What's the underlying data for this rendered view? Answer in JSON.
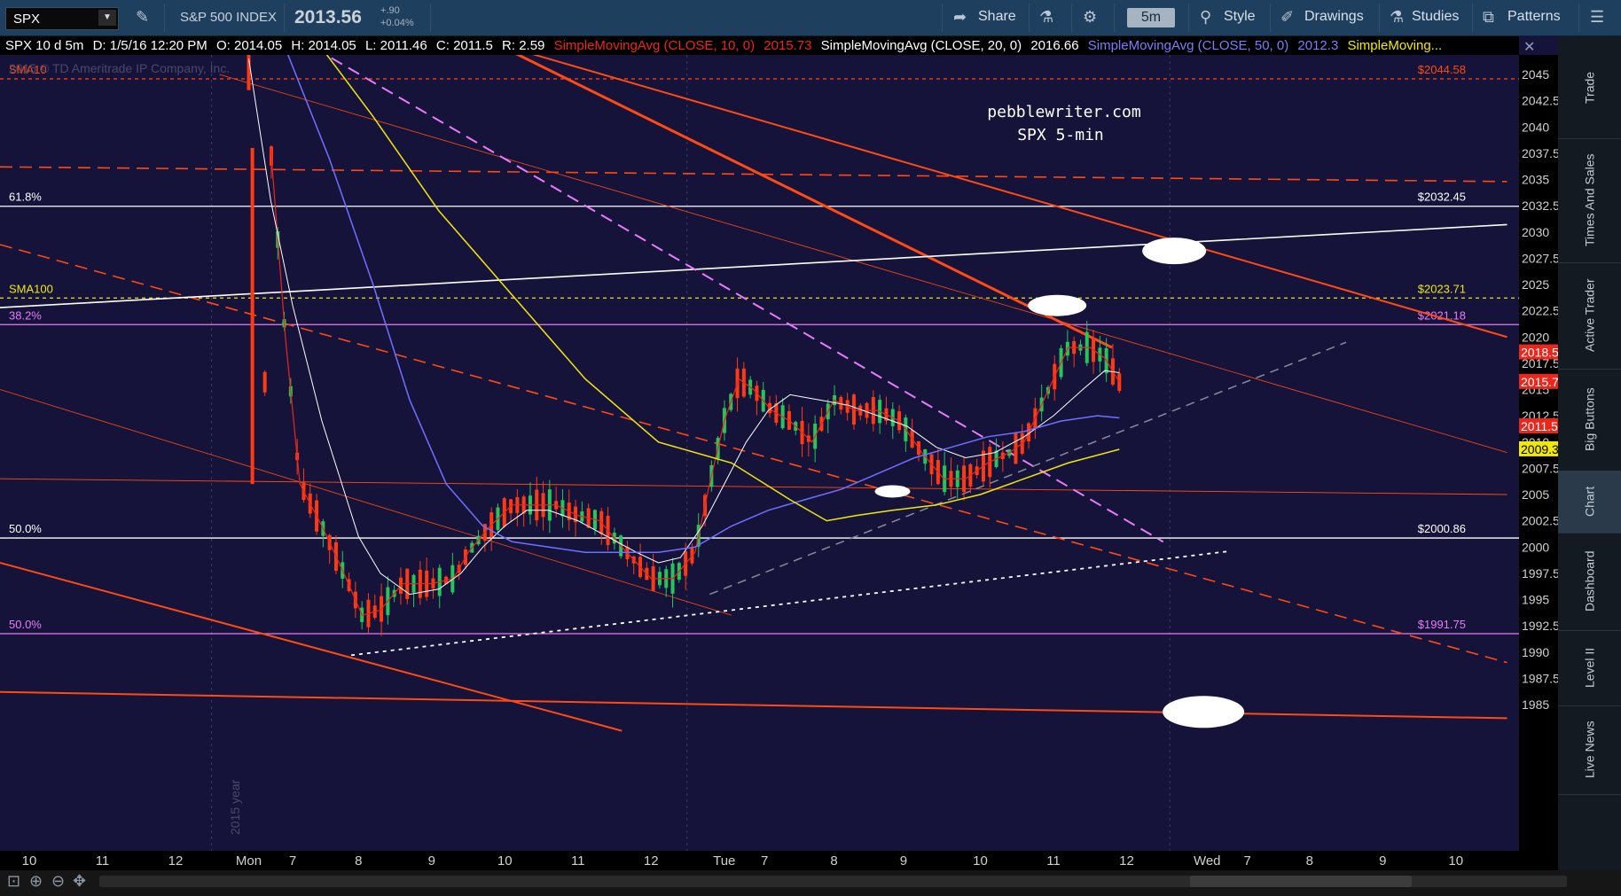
{
  "toolbar": {
    "symbol": "SPX",
    "index_name": "S&P 500 INDEX",
    "price": "2013.56",
    "change_abs": "+.90",
    "change_pct": "+0.04%",
    "share_label": "Share",
    "timeframe": "5m",
    "style_label": "Style",
    "drawings_label": "Drawings",
    "studies_label": "Studies",
    "patterns_label": "Patterns"
  },
  "info_bar": {
    "title": "SPX 10 d 5m",
    "date": "D: 1/5/16 12:20 PM",
    "open": "O: 2014.05",
    "high": "H: 2014.05",
    "low": "L: 2011.46",
    "close": "C: 2011.5",
    "range": "R: 2.59",
    "sma10_label": "SimpleMovingAvg (CLOSE, 10, 0)",
    "sma10_value": "2015.73",
    "sma20_label": "SimpleMovingAvg (CLOSE, 20, 0)",
    "sma20_value": "2016.66",
    "sma50_label": "SimpleMovingAvg (CLOSE, 50, 0)",
    "sma50_value": "2012.3",
    "more_label": "SimpleMoving..."
  },
  "sidebar": {
    "tabs": [
      "Trade",
      "Times And Sales",
      "Active Trader",
      "Big Buttons",
      "Chart",
      "Dashboard",
      "Level II",
      "Live News"
    ],
    "active": "Chart"
  },
  "colors": {
    "background": "#15133a",
    "candle_up": "#27c45a",
    "candle_down": "#ff3a12",
    "sma10": "#e8271d",
    "sma20": "#ffffff",
    "sma50": "#7070ff",
    "sma100": "#f0e80a",
    "fib_white": "#ffffff",
    "fib_magenta": "#e87cf8",
    "trend_orange": "#ff4a14"
  },
  "chart_data": {
    "type": "line",
    "title": "pebblewriter.com",
    "subtitle": "SPX 5-min",
    "copyright": "2015 © TD Ameritrade IP Company, Inc.",
    "year_marker": "2015 year",
    "ylim": [
      1982.5,
      2047.5
    ],
    "y_ticks": [
      2045,
      2042.5,
      2040,
      2037.5,
      2035,
      2032.5,
      2030,
      2027.5,
      2025,
      2022.5,
      2020,
      2017.5,
      2015,
      2012.5,
      2010,
      2007.5,
      2005,
      2002.5,
      2000,
      1997.5,
      1995,
      1992.5,
      1990,
      1987.5,
      1985
    ],
    "y_tick_labels": [
      "2045",
      "2042.5",
      "2040",
      "2037.5",
      "2035",
      "2032.5",
      "2030",
      "2027.5",
      "2025",
      "2022.5",
      "2020",
      "2017.5",
      "2015",
      "2012.5",
      "2010",
      "2007.5",
      "2005",
      "2002.5",
      "2000",
      "1997.5",
      "1995",
      "1992.5",
      "1990",
      "1987.5",
      "1985"
    ],
    "xlim": [
      0,
      20.6
    ],
    "x_ticks": [
      {
        "x": 0.4,
        "label": "10"
      },
      {
        "x": 1.4,
        "label": "11"
      },
      {
        "x": 2.4,
        "label": "12"
      },
      {
        "x": 3.4,
        "label": "Mon"
      },
      {
        "x": 4,
        "label": "7"
      },
      {
        "x": 4.9,
        "label": "8"
      },
      {
        "x": 5.9,
        "label": "9"
      },
      {
        "x": 6.9,
        "label": "10"
      },
      {
        "x": 7.9,
        "label": "11"
      },
      {
        "x": 8.9,
        "label": "12"
      },
      {
        "x": 9.9,
        "label": "Tue"
      },
      {
        "x": 10.45,
        "label": "7"
      },
      {
        "x": 11.4,
        "label": "8"
      },
      {
        "x": 12.35,
        "label": "9"
      },
      {
        "x": 13.4,
        "label": "10"
      },
      {
        "x": 14.4,
        "label": "11"
      },
      {
        "x": 15.4,
        "label": "12"
      },
      {
        "x": 16.5,
        "label": "Wed"
      },
      {
        "x": 17.05,
        "label": "7"
      },
      {
        "x": 17.9,
        "label": "8"
      },
      {
        "x": 18.9,
        "label": "9"
      },
      {
        "x": 19.9,
        "label": "10"
      }
    ],
    "price_tags": [
      {
        "label": "$2044.58",
        "y": 2044.58,
        "color": "#ff4a14"
      },
      {
        "label": "$2032.45",
        "y": 2032.45,
        "color": "#ffffff"
      },
      {
        "label": "$2023.71",
        "y": 2023.71,
        "color": "#f0e80a"
      },
      {
        "label": "$2021.18",
        "y": 2021.18,
        "color": "#e87cf8"
      },
      {
        "label": "$2000.86",
        "y": 2000.86,
        "color": "#ffffff"
      },
      {
        "label": "$1991.75",
        "y": 1991.75,
        "color": "#e87cf8"
      }
    ],
    "axis_badges": [
      {
        "label": "2018.54",
        "y": 2018.54,
        "bg": "#e8271d",
        "fg": "#ffffff"
      },
      {
        "label": "2015.73",
        "y": 2015.73,
        "bg": "#e8271d",
        "fg": "#ffffff"
      },
      {
        "label": "2011.5",
        "y": 2011.5,
        "bg": "#e8271d",
        "fg": "#ffffff"
      },
      {
        "label": "2009.31",
        "y": 2009.31,
        "bg": "#f0e80a",
        "fg": "#000000"
      }
    ],
    "level_labels": [
      {
        "label": "SMA10",
        "y": 2044.58,
        "color": "#ff4a14"
      },
      {
        "label": "61.8%",
        "y": 2032.45,
        "color": "#ffffff"
      },
      {
        "label": "SMA100",
        "y": 2023.71,
        "color": "#f0e80a"
      },
      {
        "label": "38.2%",
        "y": 2021.18,
        "color": "#e87cf8"
      },
      {
        "label": "50.0%",
        "y": 2000.86,
        "color": "#ffffff"
      },
      {
        "label": "50.0%",
        "y": 1991.75,
        "color": "#e87cf8"
      }
    ],
    "series": [
      {
        "name": "SimpleMovingAvg (CLOSE, 10, 0)",
        "color": "#e8271d",
        "width": 1.2,
        "points": [
          [
            3.7,
            2038
          ],
          [
            3.9,
            2020
          ],
          [
            4.1,
            2006
          ],
          [
            4.4,
            2002
          ],
          [
            4.7,
            1997.5
          ],
          [
            4.95,
            1993.5
          ],
          [
            5.2,
            1994
          ],
          [
            5.5,
            1996.5
          ],
          [
            5.9,
            1996.5
          ],
          [
            6.2,
            1997
          ],
          [
            6.4,
            1999.5
          ],
          [
            6.7,
            2002
          ],
          [
            7.0,
            2004
          ],
          [
            7.3,
            2004
          ],
          [
            7.6,
            2004
          ],
          [
            7.9,
            2003
          ],
          [
            8.2,
            2002.5
          ],
          [
            8.5,
            2000
          ],
          [
            8.9,
            1997
          ],
          [
            9.2,
            1997
          ],
          [
            9.5,
            1999.5
          ],
          [
            9.7,
            2006
          ],
          [
            9.9,
            2012
          ],
          [
            10.1,
            2016
          ],
          [
            10.3,
            2015
          ],
          [
            10.55,
            2013
          ],
          [
            10.8,
            2012
          ],
          [
            11.1,
            2010
          ],
          [
            11.4,
            2014
          ],
          [
            11.7,
            2013
          ],
          [
            12.0,
            2013
          ],
          [
            12.3,
            2012
          ],
          [
            12.6,
            2009
          ],
          [
            12.9,
            2006.5
          ],
          [
            13.2,
            2006.5
          ],
          [
            13.5,
            2008
          ],
          [
            13.8,
            2009
          ],
          [
            14.0,
            2010
          ],
          [
            14.2,
            2013
          ],
          [
            14.4,
            2016
          ],
          [
            14.6,
            2019
          ],
          [
            14.9,
            2019
          ],
          [
            15.1,
            2018
          ],
          [
            15.3,
            2015.7
          ]
        ]
      },
      {
        "name": "SimpleMovingAvg (CLOSE, 20, 0)",
        "color": "#ffffff",
        "width": 1,
        "points": [
          [
            3.4,
            2046.5
          ],
          [
            3.7,
            2033
          ],
          [
            4.0,
            2023
          ],
          [
            4.4,
            2012
          ],
          [
            4.9,
            2001
          ],
          [
            5.2,
            1997.5
          ],
          [
            5.6,
            1995.5
          ],
          [
            6.0,
            1996
          ],
          [
            6.3,
            1997.5
          ],
          [
            6.6,
            2000
          ],
          [
            6.9,
            2002
          ],
          [
            7.2,
            2003.5
          ],
          [
            7.5,
            2003.5
          ],
          [
            7.9,
            2002.5
          ],
          [
            8.3,
            2001
          ],
          [
            8.7,
            1999.5
          ],
          [
            9.0,
            1998.5
          ],
          [
            9.3,
            1999
          ],
          [
            9.6,
            2002
          ],
          [
            9.9,
            2006
          ],
          [
            10.2,
            2010
          ],
          [
            10.5,
            2013
          ],
          [
            10.8,
            2014.5
          ],
          [
            11.2,
            2014
          ],
          [
            11.6,
            2013.5
          ],
          [
            12.0,
            2012.5
          ],
          [
            12.4,
            2011.5
          ],
          [
            12.8,
            2009.5
          ],
          [
            13.2,
            2008.5
          ],
          [
            13.6,
            2009
          ],
          [
            14.0,
            2010.5
          ],
          [
            14.4,
            2012.5
          ],
          [
            14.8,
            2015
          ],
          [
            15.1,
            2016.8
          ],
          [
            15.3,
            2016.6
          ]
        ]
      },
      {
        "name": "SimpleMovingAvg (CLOSE, 50, 0)",
        "color": "#7070ff",
        "width": 1.5,
        "points": [
          [
            3.9,
            2047.5
          ],
          [
            4.5,
            2037
          ],
          [
            5.1,
            2025
          ],
          [
            5.6,
            2014
          ],
          [
            6.1,
            2006
          ],
          [
            6.6,
            2002
          ],
          [
            7.0,
            2000.5
          ],
          [
            7.5,
            2000
          ],
          [
            8.0,
            1999.5
          ],
          [
            8.5,
            1999.5
          ],
          [
            9.0,
            1999.5
          ],
          [
            9.5,
            2000
          ],
          [
            10.0,
            2002
          ],
          [
            10.5,
            2003.5
          ],
          [
            11.0,
            2004.5
          ],
          [
            11.5,
            2005.5
          ],
          [
            12.0,
            2007
          ],
          [
            12.5,
            2008.5
          ],
          [
            13.0,
            2009.5
          ],
          [
            13.5,
            2010.5
          ],
          [
            14.0,
            2011
          ],
          [
            14.5,
            2012
          ],
          [
            15.0,
            2012.5
          ],
          [
            15.3,
            2012.3
          ]
        ]
      },
      {
        "name": "SMA100",
        "color": "#f0e80a",
        "width": 1.5,
        "points": [
          [
            4.4,
            2047.5
          ],
          [
            5.1,
            2041
          ],
          [
            6.0,
            2032
          ],
          [
            7.0,
            2024
          ],
          [
            8.0,
            2016
          ],
          [
            9.0,
            2010
          ],
          [
            10.0,
            2008
          ],
          [
            10.8,
            2004.5
          ],
          [
            11.3,
            2002.5
          ],
          [
            11.7,
            2003
          ],
          [
            12.2,
            2003.5
          ],
          [
            12.8,
            2004
          ],
          [
            13.4,
            2005
          ],
          [
            14.0,
            2006.5
          ],
          [
            14.6,
            2008
          ],
          [
            15.3,
            2009.3
          ]
        ]
      }
    ],
    "candles": {
      "up_count": 62,
      "down_count": 71,
      "close": 2011.5,
      "low_mon": 1990.4,
      "high_tue": 2021.5,
      "high_wed_morning": 2022
    },
    "trendlines": [
      {
        "name": "descending-channel-top",
        "color": "#ff4a14",
        "width": 3,
        "dash": "",
        "points": [
          [
            6.9,
            2047.5
          ],
          [
            15.2,
            2019
          ]
        ]
      },
      {
        "name": "descending-channel-upper",
        "color": "#ff4a14",
        "width": 2,
        "dash": "",
        "points": [
          [
            7.0,
            2047.5
          ],
          [
            20.6,
            2020
          ]
        ]
      },
      {
        "name": "descending-thin-upper",
        "color": "#ff4a14",
        "width": 0.8,
        "dash": "",
        "points": [
          [
            3.0,
            2045
          ],
          [
            20.6,
            2009
          ]
        ]
      },
      {
        "name": "descending-dashed-mid",
        "color": "#ff4a14",
        "width": 1.6,
        "dash": "14,8",
        "points": [
          [
            0,
            2028.8
          ],
          [
            20.6,
            1989
          ]
        ]
      },
      {
        "name": "descending-thin-lower",
        "color": "#ff4a14",
        "width": 0.8,
        "dash": "",
        "points": [
          [
            0,
            2015
          ],
          [
            10.0,
            1993.5
          ]
        ]
      },
      {
        "name": "descending-channel-bottom",
        "color": "#ff4a14",
        "width": 2,
        "dash": "",
        "points": [
          [
            0,
            1998.5
          ],
          [
            8.5,
            1982.5
          ]
        ]
      },
      {
        "name": "horizontal-low",
        "color": "#ff4a14",
        "width": 2,
        "dash": "",
        "points": [
          [
            0,
            1986.2
          ],
          [
            20.6,
            1983.7
          ]
        ]
      },
      {
        "name": "near-flat-mid",
        "color": "#ff4a14",
        "width": 0.9,
        "dash": "",
        "points": [
          [
            0,
            2006.5
          ],
          [
            20.6,
            2005
          ]
        ]
      },
      {
        "name": "dashed-upper-flat",
        "color": "#ff4a14",
        "width": 1.6,
        "dash": "14,8",
        "points": [
          [
            0,
            2036.2
          ],
          [
            20.6,
            2034.8
          ]
        ]
      },
      {
        "name": "rising-white-line",
        "color": "#ffffff",
        "width": 1.6,
        "dash": "",
        "points": [
          [
            0,
            2022.8
          ],
          [
            20.6,
            2030.7
          ]
        ]
      },
      {
        "name": "magenta-dashed-fall",
        "color": "#e87cf8",
        "width": 2,
        "dash": "14,8",
        "points": [
          [
            4.3,
            2047.5
          ],
          [
            15.9,
            2000.5
          ]
        ]
      },
      {
        "name": "grey-dashed-rise",
        "color": "#8a8a9a",
        "width": 1.5,
        "dash": "10,7",
        "points": [
          [
            9.7,
            1995.5
          ],
          [
            18.4,
            2019.5
          ]
        ]
      },
      {
        "name": "white-dotted-rise",
        "color": "#ffffff",
        "width": 1.8,
        "dash": "4,5",
        "points": [
          [
            4.8,
            1989.7
          ],
          [
            16.8,
            1999.6
          ]
        ]
      }
    ],
    "ellipses": [
      {
        "x": 16.05,
        "y": 2028.2,
        "rx": 36,
        "ry": 15
      },
      {
        "x": 14.45,
        "y": 2023,
        "rx": 33,
        "ry": 12
      },
      {
        "x": 12.2,
        "y": 2005.3,
        "rx": 20,
        "ry": 7
      },
      {
        "x": 16.45,
        "y": 1984.3,
        "rx": 46,
        "ry": 18
      }
    ],
    "grid": false,
    "legend": "top"
  }
}
